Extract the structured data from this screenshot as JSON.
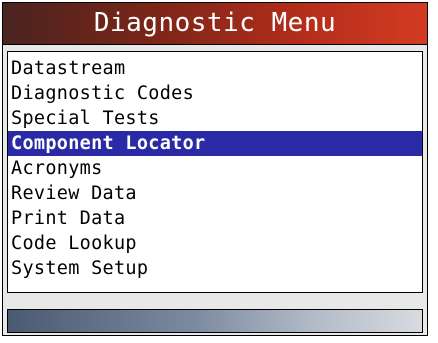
{
  "header": {
    "title": "Diagnostic Menu"
  },
  "menu": {
    "selected_index": 3,
    "items": [
      {
        "label": "Datastream"
      },
      {
        "label": "Diagnostic Codes"
      },
      {
        "label": "Special Tests"
      },
      {
        "label": "Component Locator"
      },
      {
        "label": "Acronyms"
      },
      {
        "label": "Review Data"
      },
      {
        "label": "Print Data"
      },
      {
        "label": "Code Lookup"
      },
      {
        "label": "System Setup"
      }
    ]
  },
  "colors": {
    "title_bar_accent": "#c4321e",
    "selection": "#2a2aa6",
    "status_bar": "#7c8aa0"
  }
}
